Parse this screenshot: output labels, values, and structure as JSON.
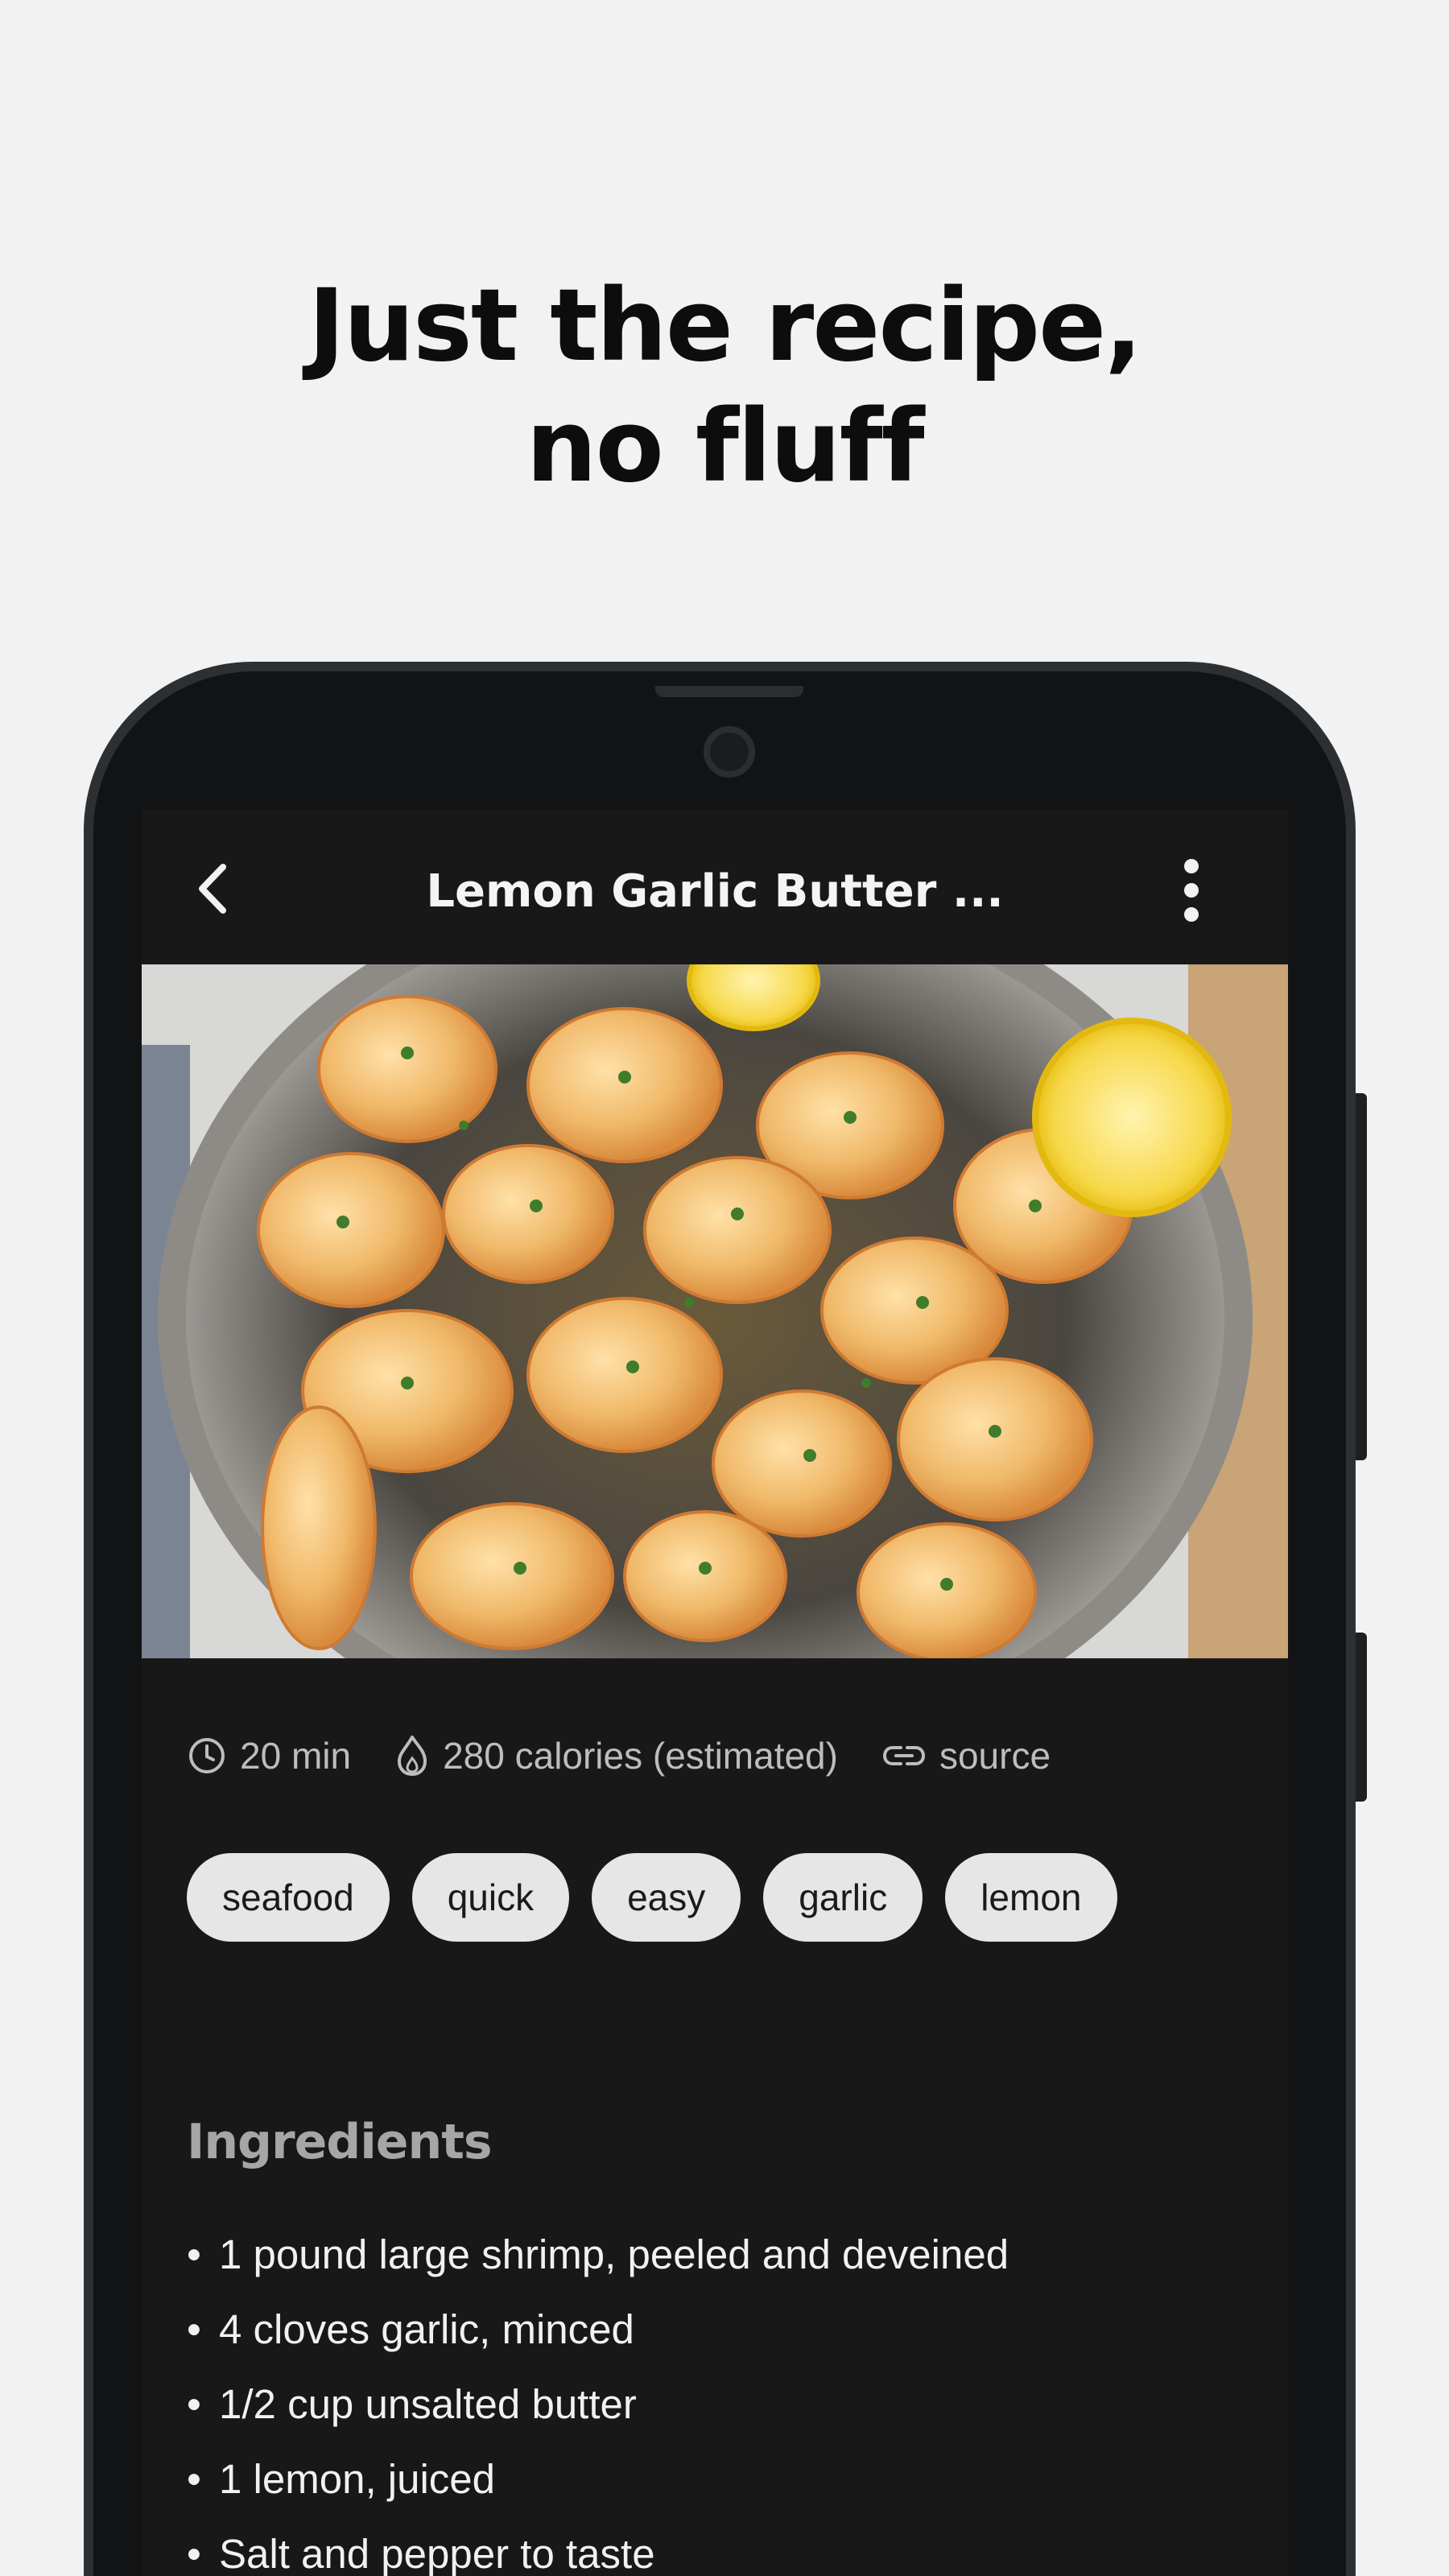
{
  "headline": {
    "line1": "Just the recipe,",
    "line2": "no fluff"
  },
  "appbar": {
    "title": "Lemon Garlic Butter ...",
    "back_icon": "chevron-left-icon",
    "more_icon": "more-vertical-icon"
  },
  "hero_image": {
    "description": "lemon-garlic-butter-shrimp-photo"
  },
  "meta": {
    "time": "20 min",
    "calories": "280 calories (estimated)",
    "source": "source"
  },
  "tags": [
    "seafood",
    "quick",
    "easy",
    "garlic",
    "lemon"
  ],
  "ingredients": {
    "title": "Ingredients",
    "bullet": "•",
    "items": [
      "1 pound large shrimp, peeled and deveined",
      "4 cloves garlic, minced",
      "1/2 cup unsalted butter",
      "1 lemon, juiced",
      "Salt and pepper to taste"
    ]
  },
  "colors": {
    "page_bg": "#f2f2f2",
    "screen_bg": "#181819",
    "tag_bg": "#e6e6e6",
    "muted_text": "#bdbdbd"
  }
}
